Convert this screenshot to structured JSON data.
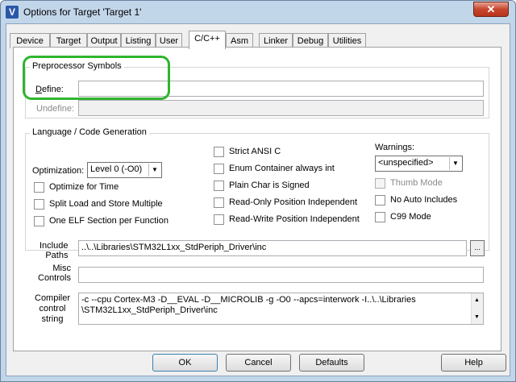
{
  "window": {
    "title": "Options for Target 'Target 1'",
    "close_glyph": "✕",
    "app_icon_glyph": "V"
  },
  "tabs": [
    {
      "label": "Device"
    },
    {
      "label": "Target"
    },
    {
      "label": "Output"
    },
    {
      "label": "Listing"
    },
    {
      "label": "User"
    },
    {
      "label": "C/C++",
      "active": true
    },
    {
      "label": "Asm"
    },
    {
      "label": "Linker"
    },
    {
      "label": "Debug"
    },
    {
      "label": "Utilities"
    }
  ],
  "preprocessor": {
    "title": "Preprocessor Symbols",
    "define_label": "Define:",
    "define_value": "",
    "undefine_label": "Undefine:",
    "undefine_value": ""
  },
  "language": {
    "title": "Language / Code Generation",
    "optimization_label": "Optimization:",
    "optimization_value": "Level 0 (-O0)",
    "optimize_time": "Optimize for Time",
    "split_load": "Split Load and Store Multiple",
    "one_elf": "One ELF Section per Function",
    "strict_ansi": "Strict ANSI C",
    "enum_container": "Enum Container always int",
    "plain_char": "Plain Char is Signed",
    "ropi": "Read-Only Position Independent",
    "rwpi": "Read-Write Position Independent",
    "warnings_label": "Warnings:",
    "warnings_value": "<unspecified>",
    "thumb_mode": "Thumb Mode",
    "no_auto_includes": "No Auto Includes",
    "c99_mode": "C99 Mode"
  },
  "include": {
    "label_line1": "Include",
    "label_line2": "Paths",
    "value": "..\\..\\Libraries\\STM32L1xx_StdPeriph_Driver\\inc",
    "browse": "..."
  },
  "misc": {
    "label_line1": "Misc",
    "label_line2": "Controls",
    "value": ""
  },
  "compiler": {
    "label_line1": "Compiler",
    "label_line2": "control",
    "label_line3": "string",
    "line1": "-c --cpu Cortex-M3 -D__EVAL -D__MICROLIB -g -O0 --apcs=interwork -I..\\..\\Libraries",
    "line2": "\\STM32L1xx_StdPeriph_Driver\\inc"
  },
  "buttons": {
    "ok": "OK",
    "cancel": "Cancel",
    "defaults": "Defaults",
    "help": "Help"
  },
  "colors": {
    "highlight": "#2fb52f",
    "close": "#c7462d"
  }
}
